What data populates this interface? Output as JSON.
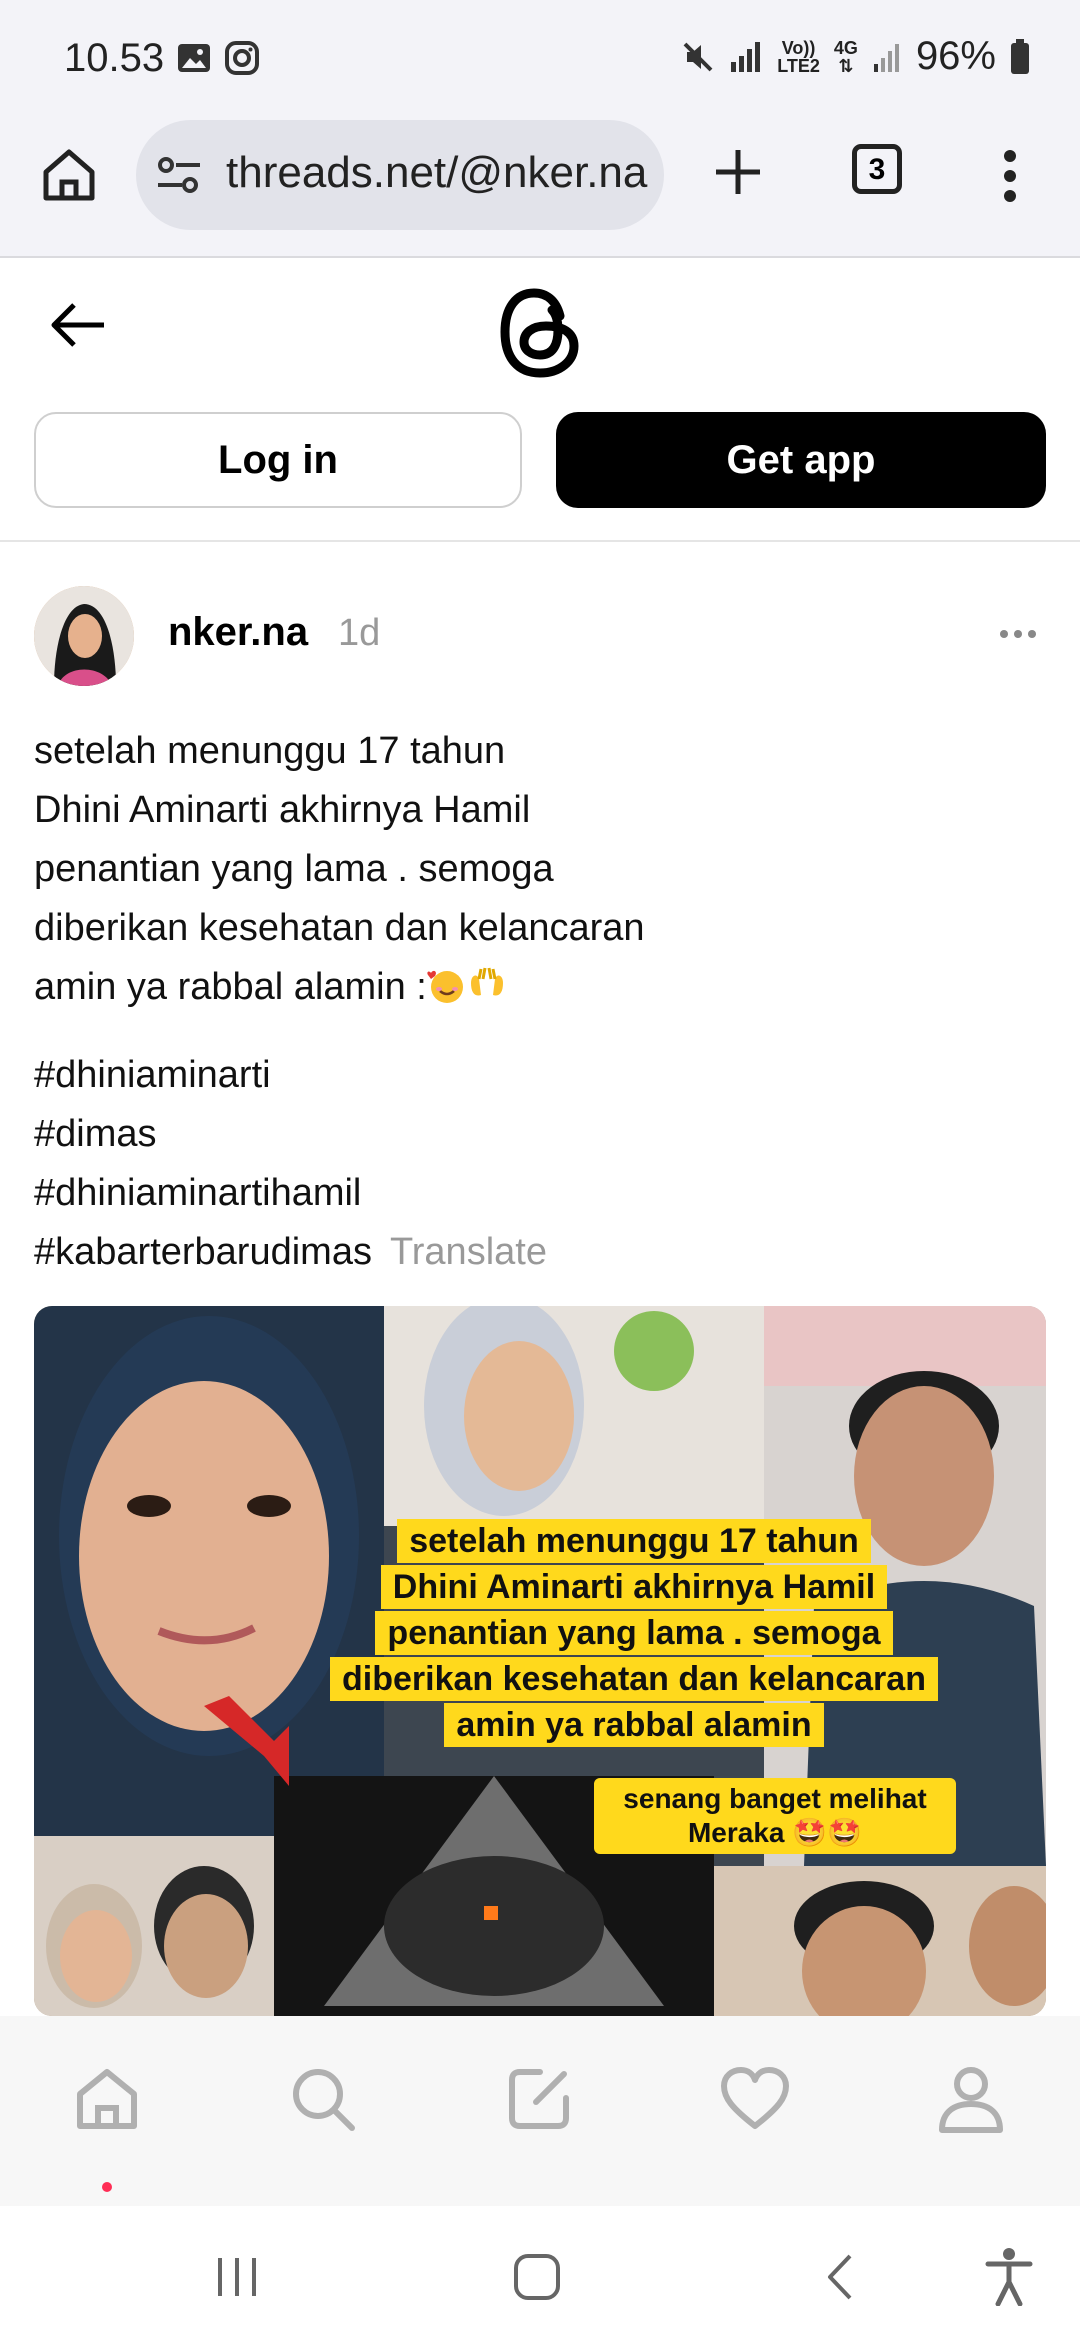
{
  "status_bar": {
    "time": "10.53",
    "volte_label_top": "Vo))",
    "volte_label_bottom": "LTE2",
    "network_label": "4G",
    "battery": "96%"
  },
  "browser": {
    "url": "threads.net/@nker.na",
    "tab_count": "3"
  },
  "header": {
    "login_label": "Log in",
    "get_app_label": "Get app"
  },
  "post": {
    "username": "nker.na",
    "time_ago": "1d",
    "text_lines": [
      "setelah menunggu 17 tahun",
      "Dhini Aminarti akhirnya Hamil",
      "penantian yang lama . semoga",
      "diberikan kesehatan dan kelancaran",
      "amin ya rabbal alamin :"
    ],
    "hashtags": [
      "#dhiniaminarti",
      "#dimas",
      "#dhiniaminartihamil",
      "#kabarterbarudimas"
    ],
    "translate_label": "Translate",
    "image": {
      "caption_lines": [
        "setelah menunggu 17 tahun",
        "Dhini Aminarti akhirnya Hamil",
        "penantian yang lama . semoga",
        "diberikan kesehatan dan kelancaran",
        "amin ya rabbal alamin"
      ],
      "badge_line1": "senang banget melihat",
      "badge_line2": "Meraka"
    }
  },
  "bottom_nav": {
    "items": [
      "home-icon",
      "search-icon",
      "compose-icon",
      "heart-icon",
      "profile-icon"
    ],
    "active_index": 0
  },
  "colors": {
    "accent_dot": "#ff2d55",
    "status_bg": "#f3f3f8",
    "url_bg": "#e2e3ea",
    "caption_bg": "#ffd91c"
  }
}
